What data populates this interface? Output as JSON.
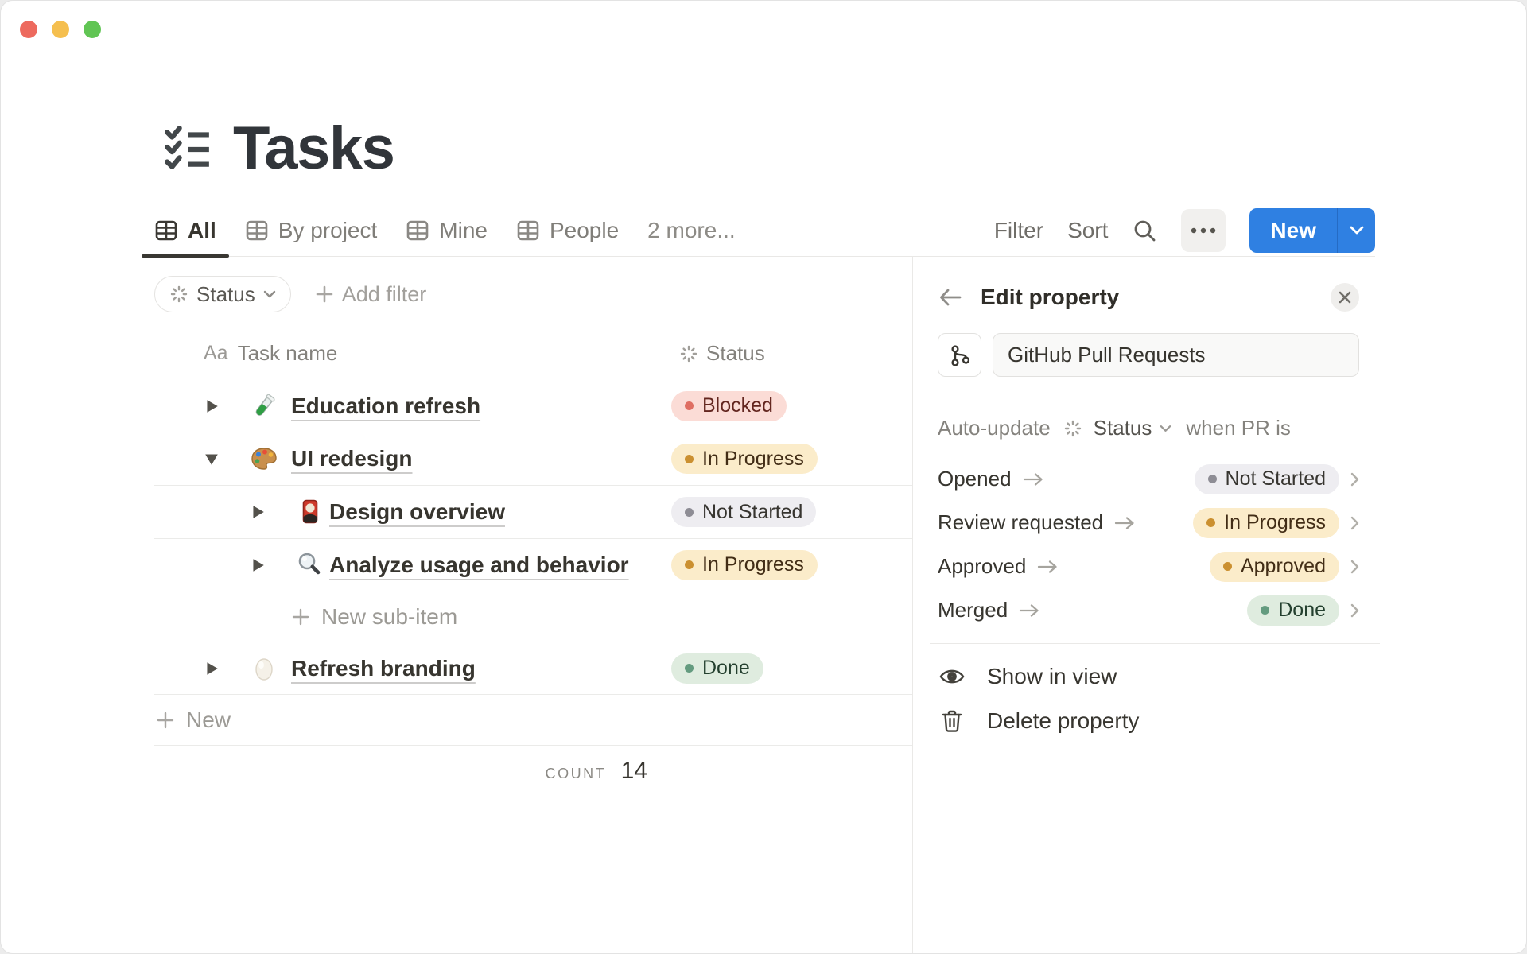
{
  "page": {
    "title": "Tasks"
  },
  "tabs": {
    "items": [
      {
        "label": "All"
      },
      {
        "label": "By project"
      },
      {
        "label": "Mine"
      },
      {
        "label": "People"
      }
    ],
    "more_label": "2 more..."
  },
  "toolbar": {
    "filter_label": "Filter",
    "sort_label": "Sort",
    "new_label": "New"
  },
  "filter_bar": {
    "status_chip_label": "Status",
    "add_filter_label": "Add filter"
  },
  "table": {
    "columns": [
      {
        "icon_label": "Aa",
        "label": "Task name"
      },
      {
        "label": "Status"
      }
    ],
    "rows": [
      {
        "title": "Education refresh",
        "emoji": "test-tube",
        "status": {
          "label": "Blocked",
          "color": "red"
        }
      },
      {
        "title": "UI redesign",
        "emoji": "artist-palette",
        "status": {
          "label": "In Progress",
          "color": "yellow"
        }
      },
      {
        "title": "Design overview",
        "emoji": "flower-playing-cards",
        "status": {
          "label": "Not Started",
          "color": "gray"
        }
      },
      {
        "title": "Analyze usage and behavior",
        "emoji": "magnifying-glass",
        "status": {
          "label": "In Progress",
          "color": "yellow"
        }
      },
      {
        "title": "Refresh branding",
        "emoji": "egg",
        "status": {
          "label": "Done",
          "color": "green"
        }
      }
    ],
    "new_sub_item_label": "New sub-item",
    "new_row_label": "New",
    "footer": {
      "count_label": "COUNT",
      "count_value": "14"
    }
  },
  "panel": {
    "title": "Edit property",
    "property_name": "GitHub Pull Requests",
    "auto_update": {
      "prefix": "Auto-update",
      "property": "Status",
      "suffix": "when PR is"
    },
    "mappings": [
      {
        "event": "Opened",
        "status": {
          "label": "Not Started",
          "color": "gray"
        }
      },
      {
        "event": "Review requested",
        "status": {
          "label": "In Progress",
          "color": "yellow"
        }
      },
      {
        "event": "Approved",
        "status": {
          "label": "Approved",
          "color": "yellow"
        }
      },
      {
        "event": "Merged",
        "status": {
          "label": "Done",
          "color": "green"
        }
      }
    ],
    "actions": {
      "show": "Show in view",
      "delete": "Delete property"
    }
  },
  "colors": {
    "accent_blue": "#2f80e2",
    "text_dark": "#37352f",
    "text_gray": "#84827d",
    "pill_red_bg": "#fbdcd6",
    "pill_red_dot": "#df6e62",
    "pill_yellow_bg": "#fbecca",
    "pill_yellow_dot": "#cb9030",
    "pill_gray_bg": "#eeedf1",
    "pill_gray_dot": "#8e8d95",
    "pill_green_bg": "#dfecdf",
    "pill_green_dot": "#649b7f",
    "traffic_red": "#ed6a5e",
    "traffic_yellow": "#f5bf4f",
    "traffic_green": "#61c554"
  }
}
